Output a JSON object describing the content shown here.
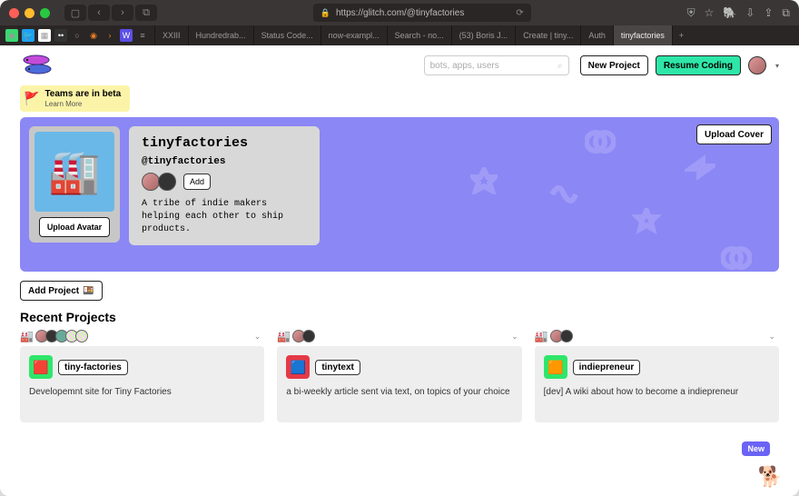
{
  "browser": {
    "url": "https://glitch.com/@tinyfactories",
    "tabs": [
      "XXIII",
      "Hundredrab...",
      "Status Code...",
      "now-exampl...",
      "Search - no...",
      "(53) Boris J...",
      "Create | tiny...",
      "Auth"
    ],
    "active_tab": "tinyfactories"
  },
  "header": {
    "search_placeholder": "bots, apps, users",
    "new_project": "New Project",
    "resume_coding": "Resume Coding"
  },
  "banner": {
    "title": "Teams are in beta",
    "learn_more": "Learn More"
  },
  "team": {
    "name": "tinyfactories",
    "handle": "@tinyfactories",
    "add_label": "Add",
    "description": "A tribe of indie makers helping each other to ship products.",
    "upload_avatar": "Upload Avatar",
    "upload_cover": "Upload Cover"
  },
  "actions": {
    "add_project": "Add Project"
  },
  "sections": {
    "recent": "Recent Projects"
  },
  "projects": [
    {
      "name": "tiny-factories",
      "description": "Developemnt site for Tiny Factories"
    },
    {
      "name": "tinytext",
      "description": "a bi-weekly article sent via text, on topics of your choice"
    },
    {
      "name": "indiepreneur",
      "description": "[dev] A wiki about how to become a indiepreneur"
    }
  ],
  "float": {
    "new_label": "New"
  }
}
